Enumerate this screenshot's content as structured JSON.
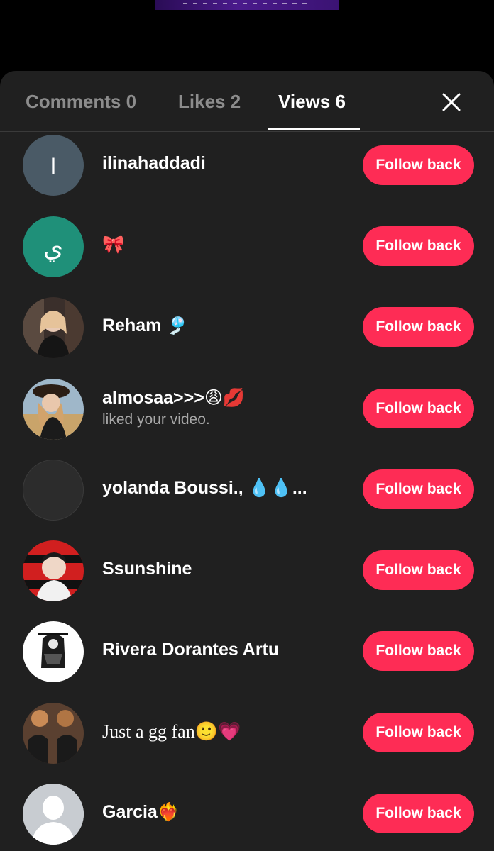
{
  "tabs": {
    "comments": "Comments 0",
    "likes": "Likes 2",
    "views": "Views 6"
  },
  "accent_color": "#fe2c55",
  "follow_label": "Follow back",
  "users": [
    {
      "name": "ilinahaddadi",
      "avatar_letter": "I",
      "avatar_color": "#4a5a66"
    },
    {
      "name": "🎀",
      "avatar_letter": "ي",
      "avatar_color": "#1f9079"
    },
    {
      "name": "Reham 🎐"
    },
    {
      "name": "almosaa>>>😩💋",
      "activity": "liked your video."
    },
    {
      "name": "yolanda Boussi., 💧💧..."
    },
    {
      "name": "Ssunshine"
    },
    {
      "name": "Rivera Dorantes Artu"
    },
    {
      "name": "Just a gg fan🙂💗"
    },
    {
      "name": "Garcia❤️‍🔥"
    }
  ]
}
